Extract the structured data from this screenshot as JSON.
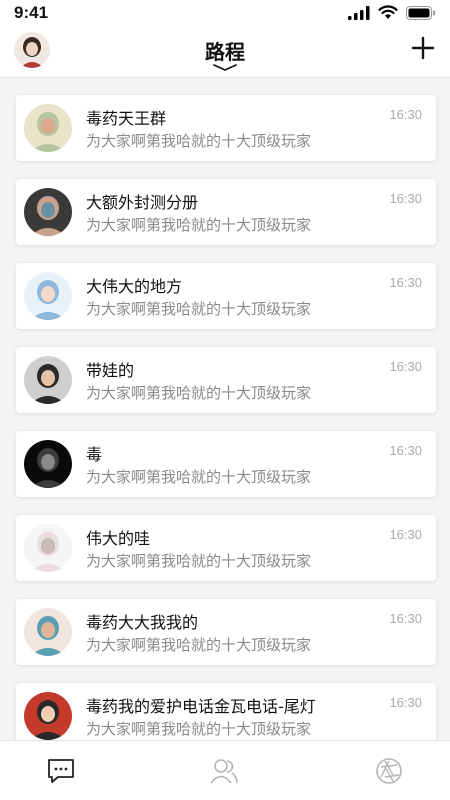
{
  "status_bar": {
    "time": "9:41",
    "icons": [
      "signal-icon",
      "wifi-icon",
      "battery-icon"
    ]
  },
  "nav": {
    "title": "路程",
    "avatar_icon": "user-avatar",
    "add_icon": "plus-icon",
    "chevron_icon": "chevron-down-icon"
  },
  "conversations": [
    {
      "title": "毒药天王群",
      "message": "为大家啊第我哈就的十大顶级玩家",
      "time": "16:30",
      "avatar_colors": [
        "#e9e4c8",
        "#b9c4a0",
        "#d8a98a"
      ]
    },
    {
      "title": "大额外封测分册",
      "message": "为大家啊第我哈就的十大顶级玩家",
      "time": "16:30",
      "avatar_colors": [
        "#3a3a3a",
        "#c9a28c",
        "#6b8fa4"
      ]
    },
    {
      "title": "大伟大的地方",
      "message": "为大家啊第我哈就的十大顶级玩家",
      "time": "16:30",
      "avatar_colors": [
        "#e8f0f8",
        "#8fb8dc",
        "#f2d9c8"
      ]
    },
    {
      "title": "带娃的",
      "message": "为大家啊第我哈就的十大顶级玩家",
      "time": "16:30",
      "avatar_colors": [
        "#cfcfcf",
        "#2a2a2a",
        "#e4c2a8"
      ]
    },
    {
      "title": "毒",
      "message": "为大家啊第我哈就的十大顶级玩家",
      "time": "16:30",
      "avatar_colors": [
        "#0a0a0a",
        "#3c3c3c",
        "#8a8a8a"
      ]
    },
    {
      "title": "伟大的哇",
      "message": "为大家啊第我哈就的十大顶级玩家",
      "time": "16:30",
      "avatar_colors": [
        "#f5f5f5",
        "#e6dede",
        "#c9b9b9"
      ]
    },
    {
      "title": "毒药大大我我的",
      "message": "为大家啊第我哈就的十大顶级玩家",
      "time": "16:30",
      "avatar_colors": [
        "#f0e6e0",
        "#5aa0b0",
        "#e0b49a"
      ]
    },
    {
      "title": "毒药我的爱护电话金瓦电话-尾灯",
      "message": "为大家啊第我哈就的十大顶级玩家",
      "time": "16:30",
      "avatar_colors": [
        "#c43a2a",
        "#2a2a2a",
        "#f0cdb4"
      ]
    }
  ],
  "tab_bar": {
    "icons": [
      "chat-bubble-icon",
      "contacts-icon",
      "discover-aperture-icon"
    ]
  }
}
